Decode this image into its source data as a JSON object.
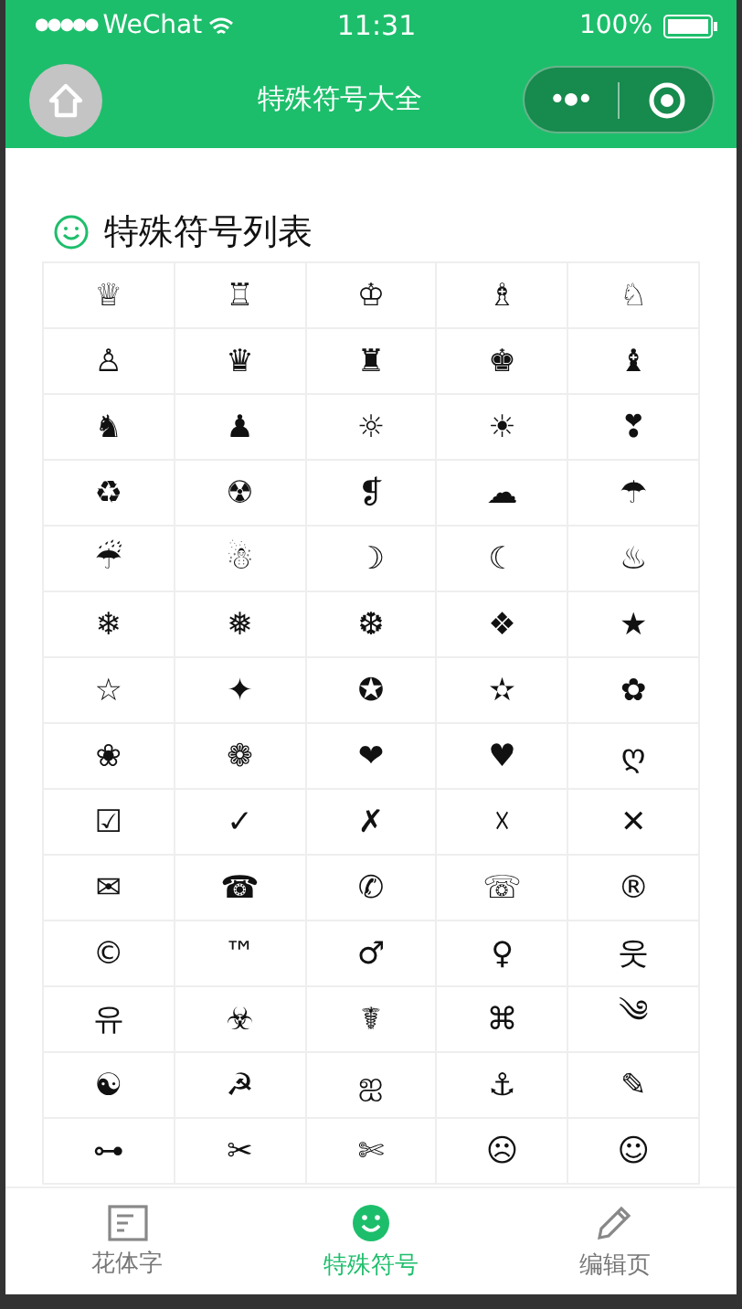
{
  "status_bar": {
    "signal": "●●●●●",
    "carrier": "WeChat",
    "time": "11:31",
    "battery": "100%"
  },
  "nav": {
    "title": "特殊符号大全",
    "menu": "•●•"
  },
  "section": {
    "title": "特殊符号列表"
  },
  "symbols": [
    "♕",
    "♖",
    "♔",
    "♗",
    "♘",
    "♙",
    "♛",
    "♜",
    "♚",
    "♝",
    "♞",
    "♟",
    "☼",
    "☀",
    "❣",
    "♻",
    "☢",
    "❡",
    "☁",
    "☂",
    "☔",
    "☃",
    "☽",
    "☾",
    "♨",
    "❄",
    "❅",
    "❆",
    "❖",
    "★",
    "☆",
    "✦",
    "✪",
    "✫",
    "✿",
    "❀",
    "❁",
    "❤",
    "♥",
    "ღ",
    "☑",
    "✓",
    "✗",
    "☓",
    "✕",
    "✉",
    "☎",
    "✆",
    "☏",
    "®",
    "©",
    "™",
    "♂",
    "♀",
    "웃",
    "유",
    "☣",
    "☤",
    "⌘",
    "༄",
    "☯",
    "☭",
    "ஐ",
    "⚓",
    "✎",
    "⊶",
    "✂",
    "✄",
    "☹",
    "☺"
  ],
  "tabs": [
    {
      "label": "花体字",
      "kind": "font",
      "selected": false
    },
    {
      "label": "特殊符号",
      "kind": "smile",
      "selected": true
    },
    {
      "label": "编辑页",
      "kind": "pencil",
      "selected": false
    }
  ]
}
